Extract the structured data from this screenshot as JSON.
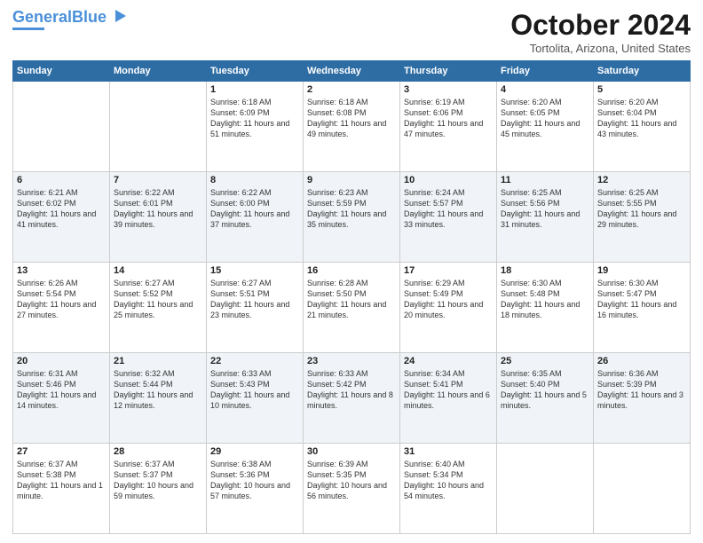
{
  "header": {
    "logo_line1": "General",
    "logo_line2": "Blue",
    "month_title": "October 2024",
    "location": "Tortolita, Arizona, United States"
  },
  "weekdays": [
    "Sunday",
    "Monday",
    "Tuesday",
    "Wednesday",
    "Thursday",
    "Friday",
    "Saturday"
  ],
  "weeks": [
    [
      {
        "day": "",
        "content": ""
      },
      {
        "day": "",
        "content": ""
      },
      {
        "day": "1",
        "content": "Sunrise: 6:18 AM\nSunset: 6:09 PM\nDaylight: 11 hours and 51 minutes."
      },
      {
        "day": "2",
        "content": "Sunrise: 6:18 AM\nSunset: 6:08 PM\nDaylight: 11 hours and 49 minutes."
      },
      {
        "day": "3",
        "content": "Sunrise: 6:19 AM\nSunset: 6:06 PM\nDaylight: 11 hours and 47 minutes."
      },
      {
        "day": "4",
        "content": "Sunrise: 6:20 AM\nSunset: 6:05 PM\nDaylight: 11 hours and 45 minutes."
      },
      {
        "day": "5",
        "content": "Sunrise: 6:20 AM\nSunset: 6:04 PM\nDaylight: 11 hours and 43 minutes."
      }
    ],
    [
      {
        "day": "6",
        "content": "Sunrise: 6:21 AM\nSunset: 6:02 PM\nDaylight: 11 hours and 41 minutes."
      },
      {
        "day": "7",
        "content": "Sunrise: 6:22 AM\nSunset: 6:01 PM\nDaylight: 11 hours and 39 minutes."
      },
      {
        "day": "8",
        "content": "Sunrise: 6:22 AM\nSunset: 6:00 PM\nDaylight: 11 hours and 37 minutes."
      },
      {
        "day": "9",
        "content": "Sunrise: 6:23 AM\nSunset: 5:59 PM\nDaylight: 11 hours and 35 minutes."
      },
      {
        "day": "10",
        "content": "Sunrise: 6:24 AM\nSunset: 5:57 PM\nDaylight: 11 hours and 33 minutes."
      },
      {
        "day": "11",
        "content": "Sunrise: 6:25 AM\nSunset: 5:56 PM\nDaylight: 11 hours and 31 minutes."
      },
      {
        "day": "12",
        "content": "Sunrise: 6:25 AM\nSunset: 5:55 PM\nDaylight: 11 hours and 29 minutes."
      }
    ],
    [
      {
        "day": "13",
        "content": "Sunrise: 6:26 AM\nSunset: 5:54 PM\nDaylight: 11 hours and 27 minutes."
      },
      {
        "day": "14",
        "content": "Sunrise: 6:27 AM\nSunset: 5:52 PM\nDaylight: 11 hours and 25 minutes."
      },
      {
        "day": "15",
        "content": "Sunrise: 6:27 AM\nSunset: 5:51 PM\nDaylight: 11 hours and 23 minutes."
      },
      {
        "day": "16",
        "content": "Sunrise: 6:28 AM\nSunset: 5:50 PM\nDaylight: 11 hours and 21 minutes."
      },
      {
        "day": "17",
        "content": "Sunrise: 6:29 AM\nSunset: 5:49 PM\nDaylight: 11 hours and 20 minutes."
      },
      {
        "day": "18",
        "content": "Sunrise: 6:30 AM\nSunset: 5:48 PM\nDaylight: 11 hours and 18 minutes."
      },
      {
        "day": "19",
        "content": "Sunrise: 6:30 AM\nSunset: 5:47 PM\nDaylight: 11 hours and 16 minutes."
      }
    ],
    [
      {
        "day": "20",
        "content": "Sunrise: 6:31 AM\nSunset: 5:46 PM\nDaylight: 11 hours and 14 minutes."
      },
      {
        "day": "21",
        "content": "Sunrise: 6:32 AM\nSunset: 5:44 PM\nDaylight: 11 hours and 12 minutes."
      },
      {
        "day": "22",
        "content": "Sunrise: 6:33 AM\nSunset: 5:43 PM\nDaylight: 11 hours and 10 minutes."
      },
      {
        "day": "23",
        "content": "Sunrise: 6:33 AM\nSunset: 5:42 PM\nDaylight: 11 hours and 8 minutes."
      },
      {
        "day": "24",
        "content": "Sunrise: 6:34 AM\nSunset: 5:41 PM\nDaylight: 11 hours and 6 minutes."
      },
      {
        "day": "25",
        "content": "Sunrise: 6:35 AM\nSunset: 5:40 PM\nDaylight: 11 hours and 5 minutes."
      },
      {
        "day": "26",
        "content": "Sunrise: 6:36 AM\nSunset: 5:39 PM\nDaylight: 11 hours and 3 minutes."
      }
    ],
    [
      {
        "day": "27",
        "content": "Sunrise: 6:37 AM\nSunset: 5:38 PM\nDaylight: 11 hours and 1 minute."
      },
      {
        "day": "28",
        "content": "Sunrise: 6:37 AM\nSunset: 5:37 PM\nDaylight: 10 hours and 59 minutes."
      },
      {
        "day": "29",
        "content": "Sunrise: 6:38 AM\nSunset: 5:36 PM\nDaylight: 10 hours and 57 minutes."
      },
      {
        "day": "30",
        "content": "Sunrise: 6:39 AM\nSunset: 5:35 PM\nDaylight: 10 hours and 56 minutes."
      },
      {
        "day": "31",
        "content": "Sunrise: 6:40 AM\nSunset: 5:34 PM\nDaylight: 10 hours and 54 minutes."
      },
      {
        "day": "",
        "content": ""
      },
      {
        "day": "",
        "content": ""
      }
    ]
  ]
}
